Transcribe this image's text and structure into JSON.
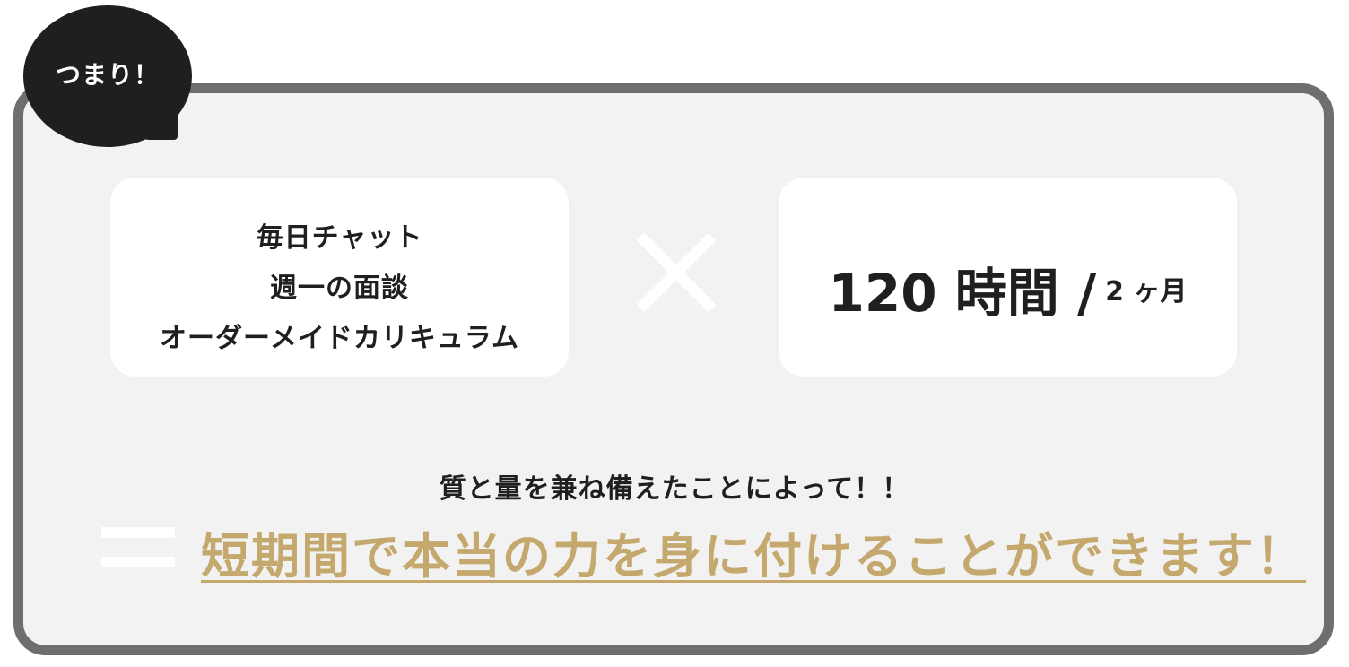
{
  "bubble": {
    "label": "つまり！"
  },
  "left_card": {
    "items": [
      "毎日チャット",
      "週一の面談",
      "オーダーメイドカリキュラム"
    ]
  },
  "right_card": {
    "main": "120 時間 /",
    "sub": "2 ヶ月"
  },
  "tagline": "質と量を兼ね備えたことによって！！",
  "headline": "短期間で本当の力を身に付けることができます！",
  "icons": {
    "multiply": "times-icon",
    "equals": "equals-icon"
  },
  "colors": {
    "accent_gold": "#c4a86e",
    "panel_border": "#6e6e6e",
    "panel_background": "#f2f2f2",
    "bubble": "#1f1f1f",
    "text": "#1f1f1f"
  }
}
